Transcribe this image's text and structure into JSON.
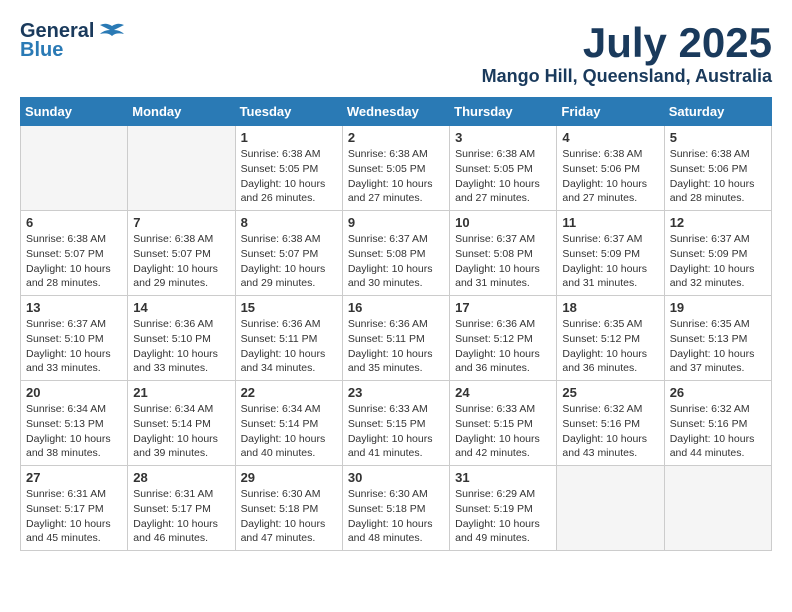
{
  "header": {
    "logo_general": "General",
    "logo_blue": "Blue",
    "month": "July 2025",
    "location": "Mango Hill, Queensland, Australia"
  },
  "days_of_week": [
    "Sunday",
    "Monday",
    "Tuesday",
    "Wednesday",
    "Thursday",
    "Friday",
    "Saturday"
  ],
  "weeks": [
    {
      "days": [
        {
          "date": "",
          "content": ""
        },
        {
          "date": "",
          "content": ""
        },
        {
          "date": "1",
          "content": "Sunrise: 6:38 AM\nSunset: 5:05 PM\nDaylight: 10 hours and 26 minutes."
        },
        {
          "date": "2",
          "content": "Sunrise: 6:38 AM\nSunset: 5:05 PM\nDaylight: 10 hours and 27 minutes."
        },
        {
          "date": "3",
          "content": "Sunrise: 6:38 AM\nSunset: 5:05 PM\nDaylight: 10 hours and 27 minutes."
        },
        {
          "date": "4",
          "content": "Sunrise: 6:38 AM\nSunset: 5:06 PM\nDaylight: 10 hours and 27 minutes."
        },
        {
          "date": "5",
          "content": "Sunrise: 6:38 AM\nSunset: 5:06 PM\nDaylight: 10 hours and 28 minutes."
        }
      ]
    },
    {
      "days": [
        {
          "date": "6",
          "content": "Sunrise: 6:38 AM\nSunset: 5:07 PM\nDaylight: 10 hours and 28 minutes."
        },
        {
          "date": "7",
          "content": "Sunrise: 6:38 AM\nSunset: 5:07 PM\nDaylight: 10 hours and 29 minutes."
        },
        {
          "date": "8",
          "content": "Sunrise: 6:38 AM\nSunset: 5:07 PM\nDaylight: 10 hours and 29 minutes."
        },
        {
          "date": "9",
          "content": "Sunrise: 6:37 AM\nSunset: 5:08 PM\nDaylight: 10 hours and 30 minutes."
        },
        {
          "date": "10",
          "content": "Sunrise: 6:37 AM\nSunset: 5:08 PM\nDaylight: 10 hours and 31 minutes."
        },
        {
          "date": "11",
          "content": "Sunrise: 6:37 AM\nSunset: 5:09 PM\nDaylight: 10 hours and 31 minutes."
        },
        {
          "date": "12",
          "content": "Sunrise: 6:37 AM\nSunset: 5:09 PM\nDaylight: 10 hours and 32 minutes."
        }
      ]
    },
    {
      "days": [
        {
          "date": "13",
          "content": "Sunrise: 6:37 AM\nSunset: 5:10 PM\nDaylight: 10 hours and 33 minutes."
        },
        {
          "date": "14",
          "content": "Sunrise: 6:36 AM\nSunset: 5:10 PM\nDaylight: 10 hours and 33 minutes."
        },
        {
          "date": "15",
          "content": "Sunrise: 6:36 AM\nSunset: 5:11 PM\nDaylight: 10 hours and 34 minutes."
        },
        {
          "date": "16",
          "content": "Sunrise: 6:36 AM\nSunset: 5:11 PM\nDaylight: 10 hours and 35 minutes."
        },
        {
          "date": "17",
          "content": "Sunrise: 6:36 AM\nSunset: 5:12 PM\nDaylight: 10 hours and 36 minutes."
        },
        {
          "date": "18",
          "content": "Sunrise: 6:35 AM\nSunset: 5:12 PM\nDaylight: 10 hours and 36 minutes."
        },
        {
          "date": "19",
          "content": "Sunrise: 6:35 AM\nSunset: 5:13 PM\nDaylight: 10 hours and 37 minutes."
        }
      ]
    },
    {
      "days": [
        {
          "date": "20",
          "content": "Sunrise: 6:34 AM\nSunset: 5:13 PM\nDaylight: 10 hours and 38 minutes."
        },
        {
          "date": "21",
          "content": "Sunrise: 6:34 AM\nSunset: 5:14 PM\nDaylight: 10 hours and 39 minutes."
        },
        {
          "date": "22",
          "content": "Sunrise: 6:34 AM\nSunset: 5:14 PM\nDaylight: 10 hours and 40 minutes."
        },
        {
          "date": "23",
          "content": "Sunrise: 6:33 AM\nSunset: 5:15 PM\nDaylight: 10 hours and 41 minutes."
        },
        {
          "date": "24",
          "content": "Sunrise: 6:33 AM\nSunset: 5:15 PM\nDaylight: 10 hours and 42 minutes."
        },
        {
          "date": "25",
          "content": "Sunrise: 6:32 AM\nSunset: 5:16 PM\nDaylight: 10 hours and 43 minutes."
        },
        {
          "date": "26",
          "content": "Sunrise: 6:32 AM\nSunset: 5:16 PM\nDaylight: 10 hours and 44 minutes."
        }
      ]
    },
    {
      "days": [
        {
          "date": "27",
          "content": "Sunrise: 6:31 AM\nSunset: 5:17 PM\nDaylight: 10 hours and 45 minutes."
        },
        {
          "date": "28",
          "content": "Sunrise: 6:31 AM\nSunset: 5:17 PM\nDaylight: 10 hours and 46 minutes."
        },
        {
          "date": "29",
          "content": "Sunrise: 6:30 AM\nSunset: 5:18 PM\nDaylight: 10 hours and 47 minutes."
        },
        {
          "date": "30",
          "content": "Sunrise: 6:30 AM\nSunset: 5:18 PM\nDaylight: 10 hours and 48 minutes."
        },
        {
          "date": "31",
          "content": "Sunrise: 6:29 AM\nSunset: 5:19 PM\nDaylight: 10 hours and 49 minutes."
        },
        {
          "date": "",
          "content": ""
        },
        {
          "date": "",
          "content": ""
        }
      ]
    }
  ]
}
